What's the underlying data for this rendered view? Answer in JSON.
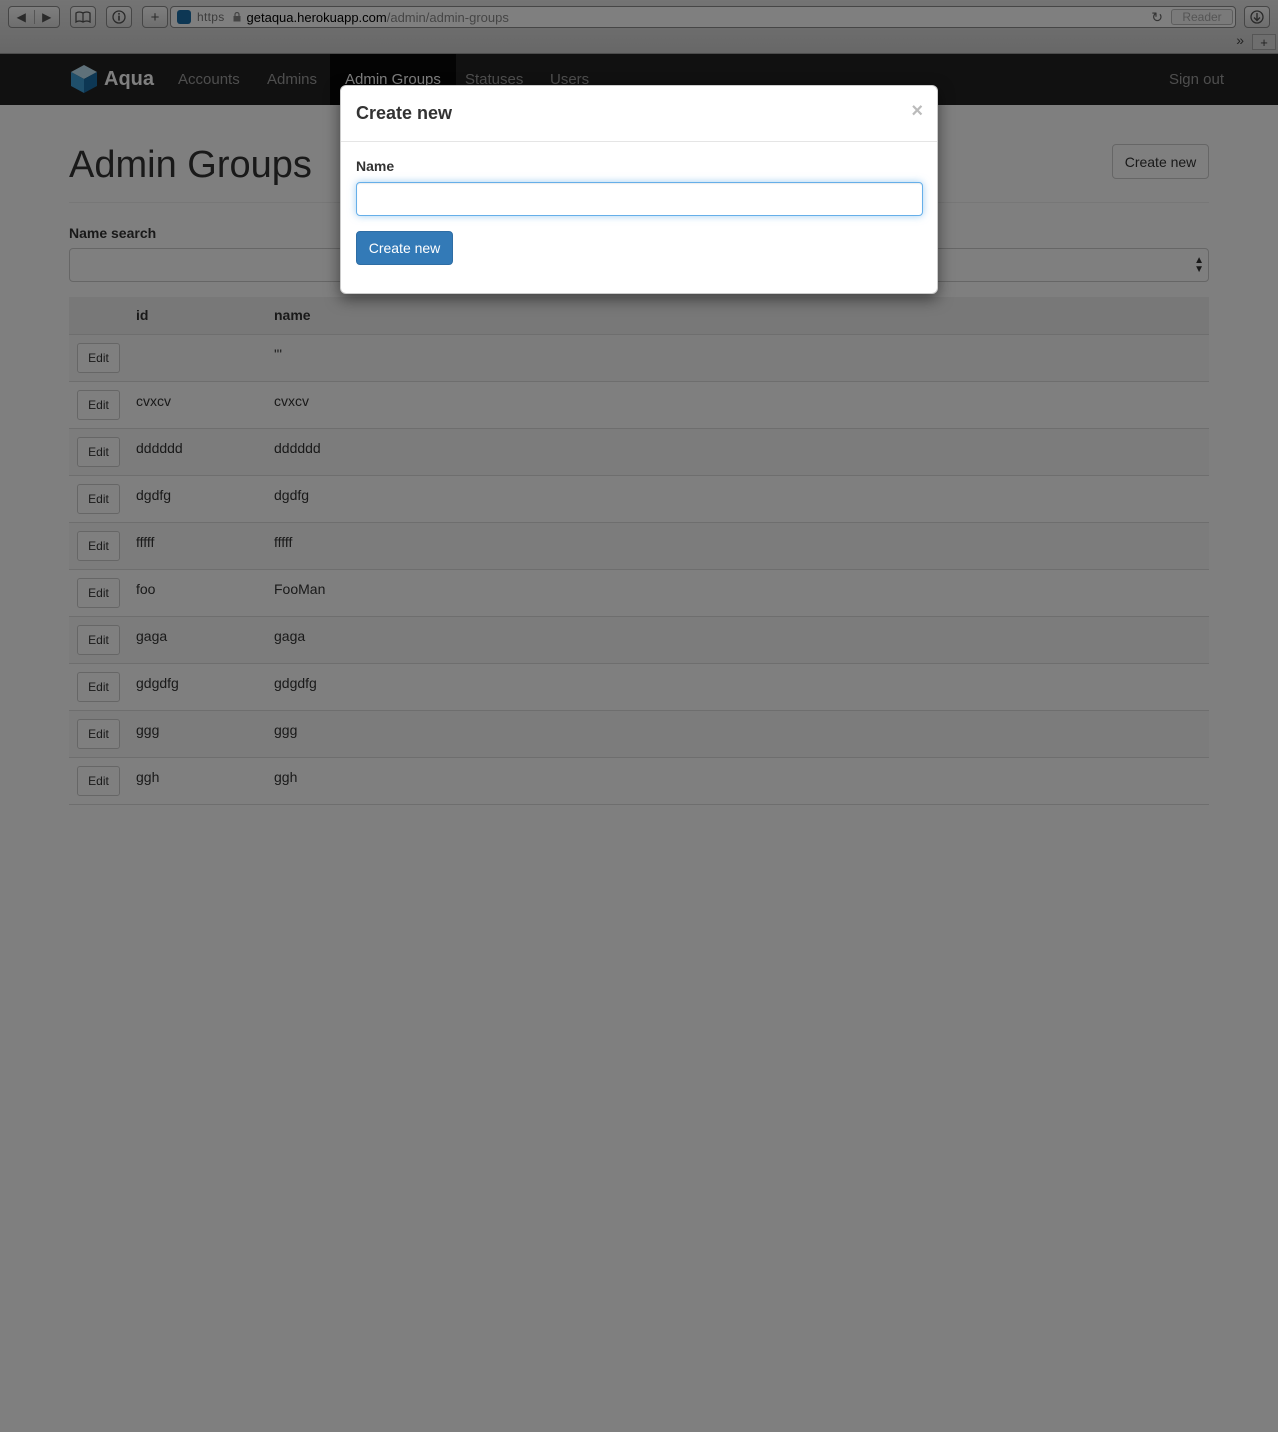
{
  "browser": {
    "nav_back": "◀",
    "nav_forward": "▶",
    "bookmarks_icon": "📖",
    "plus": "+",
    "https": "https",
    "host": "getaqua.herokuapp.com",
    "path": "/admin/admin-groups",
    "reader": "Reader",
    "overflow": "»",
    "newtab": "+"
  },
  "navbar": {
    "brand": "Aqua",
    "items": [
      {
        "label": "Accounts"
      },
      {
        "label": "Admins"
      },
      {
        "label": "Admin Groups"
      },
      {
        "label": "Statuses"
      },
      {
        "label": "Users"
      }
    ],
    "active": "Admin Groups",
    "sign_out": "Sign out"
  },
  "page": {
    "title": "Admin Groups",
    "create_button": "Create new",
    "search_label": "Name search"
  },
  "table": {
    "columns": [
      "id",
      "name"
    ],
    "edit_label": "Edit",
    "rows": [
      {
        "id": "",
        "name": "'''"
      },
      {
        "id": "cvxcv",
        "name": "cvxcv"
      },
      {
        "id": "dddddd",
        "name": "dddddd"
      },
      {
        "id": "dgdfg",
        "name": "dgdfg"
      },
      {
        "id": "fffff",
        "name": "fffff"
      },
      {
        "id": "foo",
        "name": "FooMan"
      },
      {
        "id": "gaga",
        "name": "gaga"
      },
      {
        "id": "gdgdfg",
        "name": "gdgdfg"
      },
      {
        "id": "ggg",
        "name": "ggg"
      },
      {
        "id": "ggh",
        "name": "ggh"
      }
    ]
  },
  "modal": {
    "title": "Create new",
    "close": "×",
    "name_label": "Name",
    "name_value": "",
    "submit": "Create new"
  },
  "colors": {
    "navbar_bg": "#222222",
    "primary": "#337ab7",
    "focus_border": "#66afe9"
  }
}
